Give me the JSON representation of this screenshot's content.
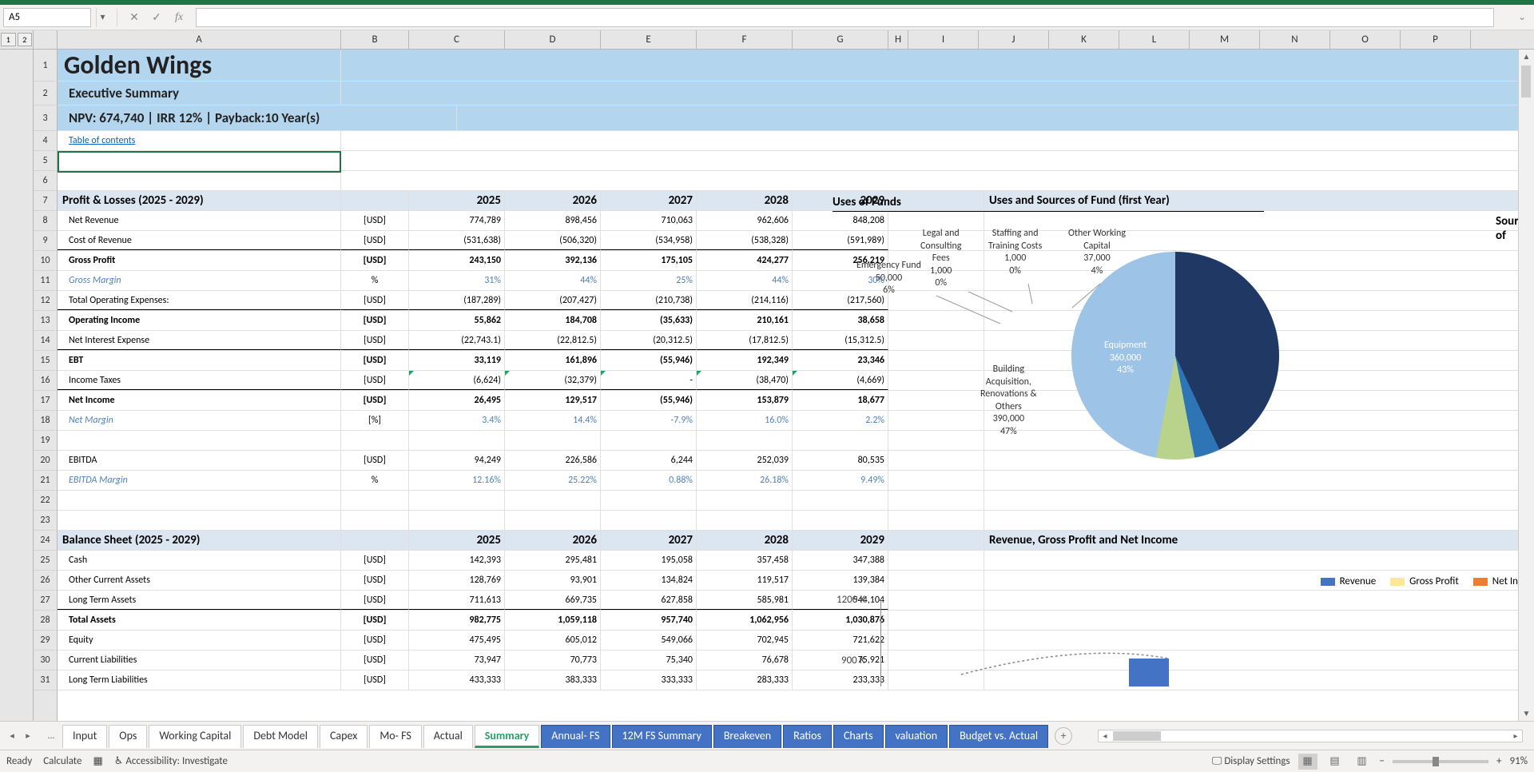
{
  "name_box": "A5",
  "formula": "",
  "outline_levels": [
    "1",
    "2"
  ],
  "columns": [
    "A",
    "B",
    "C",
    "D",
    "E",
    "F",
    "G",
    "H",
    "I",
    "J",
    "K",
    "L",
    "M",
    "N",
    "O",
    "P"
  ],
  "col_widths": {
    "A": 355,
    "B": 85,
    "C": 120,
    "D": 120,
    "E": 120,
    "F": 120,
    "G": 120,
    "H": 25,
    "chart": 650
  },
  "rows": [
    "1",
    "2",
    "3",
    "4",
    "5",
    "6",
    "7",
    "8",
    "9",
    "10",
    "11",
    "12",
    "13",
    "14",
    "15",
    "16",
    "17",
    "18",
    "19",
    "20",
    "21",
    "22",
    "23",
    "24",
    "25",
    "26",
    "27",
    "28",
    "29",
    "30",
    "31"
  ],
  "title": "Golden Wings",
  "subtitle": "Executive Summary",
  "metrics_line": "NPV: 674,740 | IRR 12% |  Payback:10 Year(s)",
  "toc_link": "Table of contents",
  "pl_header": "Profit & Losses (2025 - 2029)",
  "years": [
    "2025",
    "2026",
    "2027",
    "2028",
    "2029"
  ],
  "uses_header": "Uses and Sources of Fund (first Year)",
  "uses_sub": "Uses of Funds",
  "sources_sub": "Sources of",
  "pl_rows": [
    {
      "label": "Net Revenue",
      "unit": "[USD]",
      "vals": [
        "774,789",
        "898,456",
        "710,063",
        "962,606",
        "848,208"
      ],
      "indent": true
    },
    {
      "label": "Cost of Revenue",
      "unit": "[USD]",
      "vals": [
        "(531,638)",
        "(506,320)",
        "(534,958)",
        "(538,328)",
        "(591,989)"
      ],
      "indent": true,
      "border_bottom": true
    },
    {
      "label": "Gross Profit",
      "unit": "[USD]",
      "vals": [
        "243,150",
        "392,136",
        "175,105",
        "424,277",
        "256,219"
      ],
      "bold": true,
      "indent": true
    },
    {
      "label": "Gross Margin",
      "unit": "%",
      "vals": [
        "31%",
        "44%",
        "25%",
        "44%",
        "30%"
      ],
      "blue": true,
      "indent": true
    },
    {
      "label": "Total Operating Expenses:",
      "unit": "[USD]",
      "vals": [
        "(187,289)",
        "(207,427)",
        "(210,738)",
        "(214,116)",
        "(217,560)"
      ],
      "indent": true,
      "border_bottom": true
    },
    {
      "label": "Operating Income",
      "unit": "[USD]",
      "vals": [
        "55,862",
        "184,708",
        "(35,633)",
        "210,161",
        "38,658"
      ],
      "bold": true,
      "indent": true
    },
    {
      "label": "Net Interest Expense",
      "unit": "[USD]",
      "vals": [
        "(22,743.1)",
        "(22,812.5)",
        "(20,312.5)",
        "(17,812.5)",
        "(15,312.5)"
      ],
      "indent": true,
      "border_bottom": true
    },
    {
      "label": "EBT",
      "unit": "[USD]",
      "vals": [
        "33,119",
        "161,896",
        "(55,946)",
        "192,349",
        "23,346"
      ],
      "bold": true,
      "indent": true
    },
    {
      "label": "Income Taxes",
      "unit": "[USD]",
      "vals": [
        "(6,624)",
        "(32,379)",
        "-",
        "(38,470)",
        "(4,669)"
      ],
      "indent": true,
      "marks": true,
      "border_bottom": true
    },
    {
      "label": "Net Income",
      "unit": "[USD]",
      "vals": [
        "26,495",
        "129,517",
        "(55,946)",
        "153,879",
        "18,677"
      ],
      "bold": true,
      "indent": true,
      "border_top_thick": false
    },
    {
      "label": "Net Margin",
      "unit": "[%]",
      "vals": [
        "3.4%",
        "14.4%",
        "-7.9%",
        "16.0%",
        "2.2%"
      ],
      "blue": true,
      "indent": true
    }
  ],
  "pl_rows2": [
    {
      "label": "EBITDA",
      "unit": "[USD]",
      "vals": [
        "94,249",
        "226,586",
        "6,244",
        "252,039",
        "80,535"
      ],
      "indent": true
    },
    {
      "label": "EBITDA Margin",
      "unit": "%",
      "vals": [
        "12.16%",
        "25.22%",
        "0.88%",
        "26.18%",
        "9.49%"
      ],
      "blue": true,
      "indent": true
    }
  ],
  "bs_header": "Balance Sheet (2025 - 2029)",
  "rev_chart_header": "Revenue, Gross Profit and Net Income",
  "bs_rows": [
    {
      "label": "Cash",
      "unit": "[USD]",
      "vals": [
        "142,393",
        "295,481",
        "195,058",
        "357,458",
        "347,388"
      ],
      "indent": true
    },
    {
      "label": "Other Current Assets",
      "unit": "[USD]",
      "vals": [
        "128,769",
        "93,901",
        "134,824",
        "119,517",
        "139,384"
      ],
      "indent": true
    },
    {
      "label": "Long Term Assets",
      "unit": "[USD]",
      "vals": [
        "711,613",
        "669,735",
        "627,858",
        "585,981",
        "544,104"
      ],
      "indent": true,
      "border_bottom": true
    },
    {
      "label": "Total Assets",
      "unit": "[USD]",
      "vals": [
        "982,775",
        "1,059,118",
        "957,740",
        "1,062,956",
        "1,030,876"
      ],
      "bold": true,
      "indent": true
    },
    {
      "label": "Equity",
      "unit": "[USD]",
      "vals": [
        "475,495",
        "605,012",
        "549,066",
        "702,945",
        "721,622"
      ],
      "indent": true
    },
    {
      "label": "Current Liabilities",
      "unit": "[USD]",
      "vals": [
        "73,947",
        "70,773",
        "75,340",
        "76,678",
        "75,921"
      ],
      "indent": true
    },
    {
      "label": "Long Term Liabilities",
      "unit": "[USD]",
      "vals": [
        "433,333",
        "383,333",
        "333,333",
        "283,333",
        "233,333"
      ],
      "indent": true
    }
  ],
  "chart_data": {
    "pie": {
      "type": "pie",
      "title": "Uses of Funds",
      "slices": [
        {
          "name": "Equipment",
          "value": 360000,
          "pct": "43%",
          "color": "#1f3864"
        },
        {
          "name": "Building Acquisition, Renovations & Others",
          "value": 390000,
          "pct": "47%",
          "color": "#9dc3e6"
        },
        {
          "name": "Emergency Fund",
          "value": 50000,
          "pct": "6%",
          "color": "#70ad47"
        },
        {
          "name": "Legal and Consulting Fees",
          "value": 1000,
          "pct": "0%",
          "color": "#a9d08e"
        },
        {
          "name": "Staffing and Training Costs",
          "value": 1000,
          "pct": "0%",
          "color": "#c6e0b4"
        },
        {
          "name": "Other Working Capital",
          "value": 37000,
          "pct": "4%",
          "color": "#2e75b6"
        }
      ]
    },
    "bar": {
      "type": "bar",
      "legend": [
        "Revenue",
        "Gross Profit",
        "Net In"
      ],
      "legend_colors": [
        "#4472c4",
        "#ffe699",
        "#ed7d31"
      ],
      "y_ticks": [
        "1200 K",
        "900 K"
      ],
      "ylim": [
        0,
        1200
      ]
    }
  },
  "pie_labels": {
    "equipment": {
      "l1": "Equipment",
      "l2": "360,000",
      "l3": "43%"
    },
    "building": {
      "l1": "Building",
      "l2": "Acquisition,",
      "l3": "Renovations &",
      "l4": "Others",
      "l5": "390,000",
      "l6": "47%"
    },
    "emergency": {
      "l1": "Emergency Fund",
      "l2": "50,000",
      "l3": "6%"
    },
    "legal": {
      "l1": "Legal and",
      "l2": "Consulting",
      "l3": "Fees",
      "l4": "1,000",
      "l5": "0%"
    },
    "staffing": {
      "l1": "Staffing and",
      "l2": "Training Costs",
      "l3": "1,000",
      "l4": "0%"
    },
    "owc": {
      "l1": "Other Working",
      "l2": "Capital",
      "l3": "37,000",
      "l4": "4%"
    }
  },
  "tabs": {
    "ellipsis": "…",
    "list": [
      {
        "name": "Input",
        "style": "plain"
      },
      {
        "name": "Ops",
        "style": "plain"
      },
      {
        "name": "Working Capital",
        "style": "plain"
      },
      {
        "name": "Debt Model",
        "style": "plain"
      },
      {
        "name": "Capex",
        "style": "plain"
      },
      {
        "name": "Mo- FS",
        "style": "plain"
      },
      {
        "name": "Actual",
        "style": "plain"
      },
      {
        "name": "Summary",
        "style": "active"
      },
      {
        "name": "Annual- FS",
        "style": "blue"
      },
      {
        "name": "12M FS Summary",
        "style": "blue"
      },
      {
        "name": "Breakeven",
        "style": "blue"
      },
      {
        "name": "Ratios",
        "style": "blue"
      },
      {
        "name": "Charts",
        "style": "blue"
      },
      {
        "name": "valuation",
        "style": "blue"
      },
      {
        "name": "Budget vs. Actual",
        "style": "blue"
      }
    ]
  },
  "status": {
    "ready": "Ready",
    "calc": "Calculate",
    "access": "Accessibility: Investigate",
    "display": "Display Settings",
    "zoom": "91%"
  }
}
